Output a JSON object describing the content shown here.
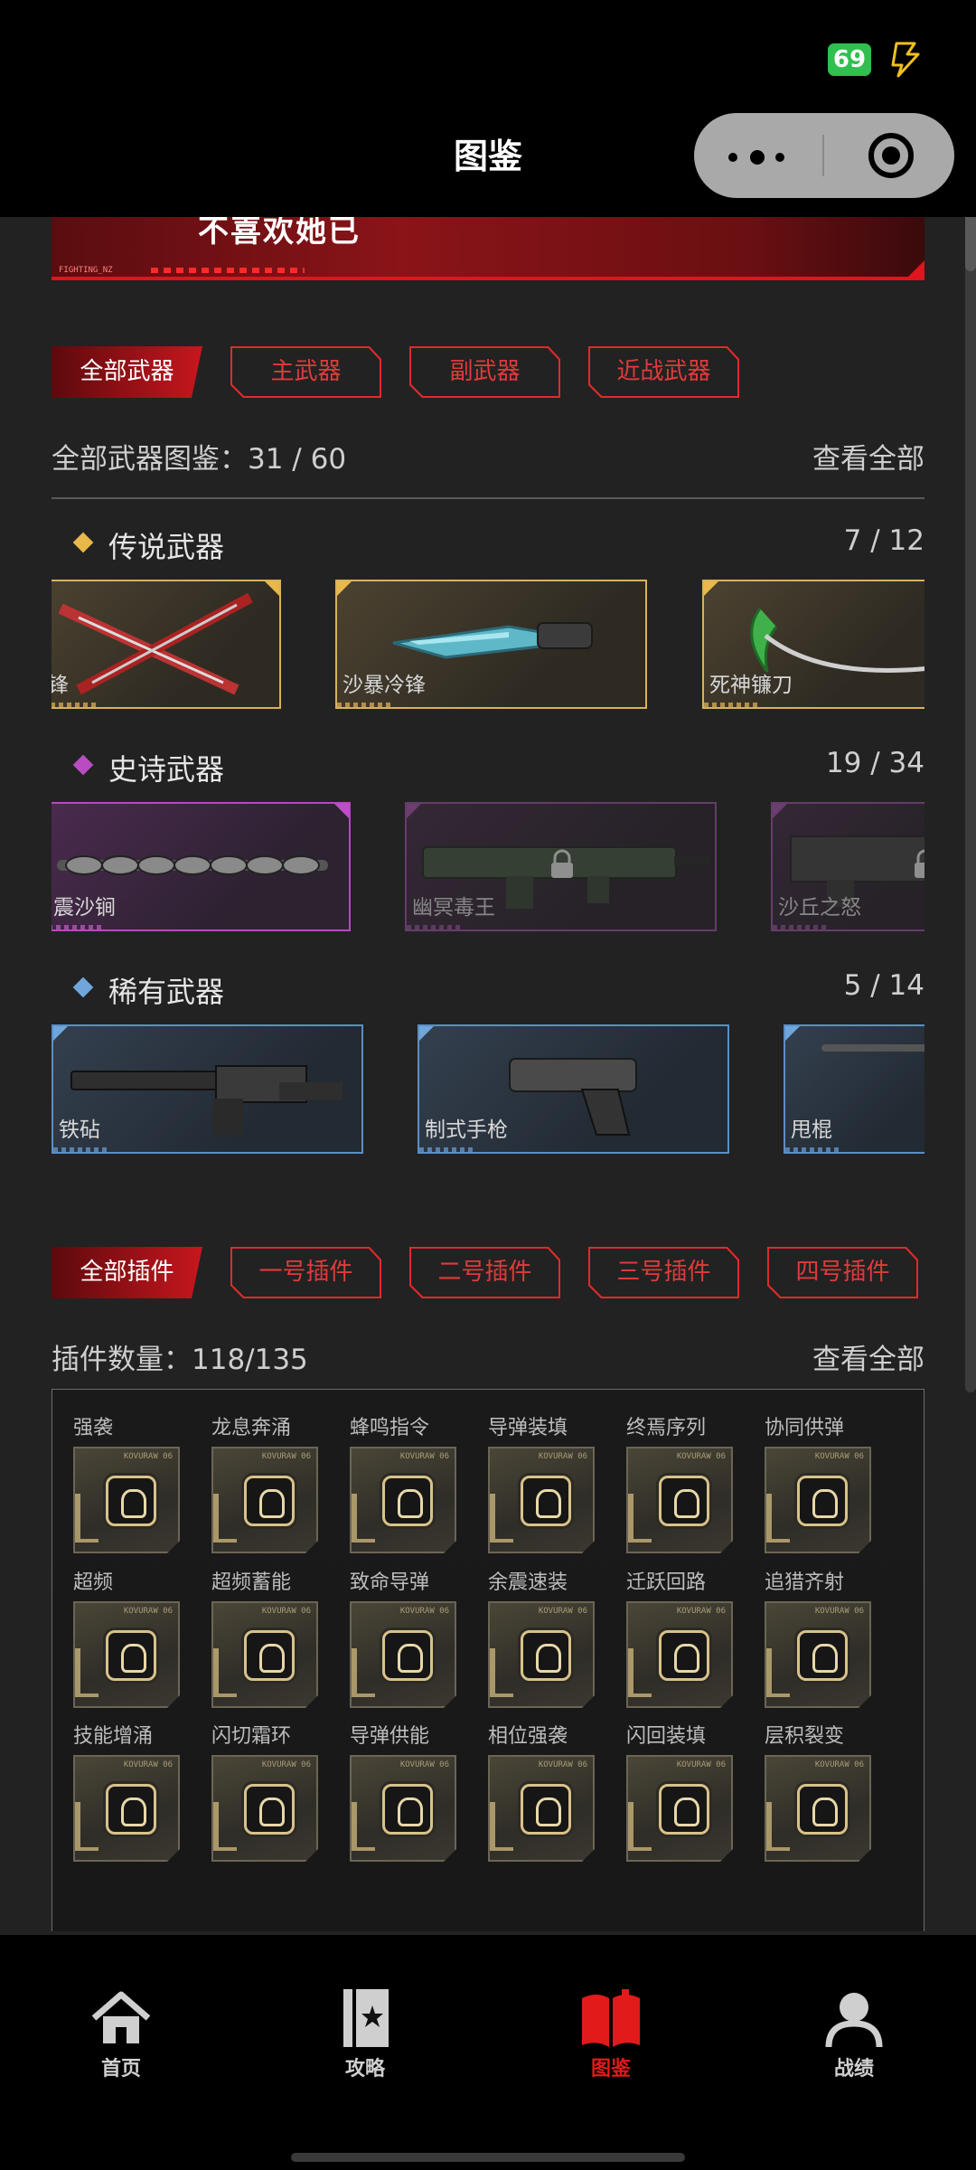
{
  "status_bar": {
    "battery": "69"
  },
  "title_bar": {
    "title": "图鉴"
  },
  "banner": {
    "text": "不喜欢她已",
    "tag": "FIGHTING_NZ"
  },
  "weapon_tabs": [
    "全部武器",
    "主武器",
    "副武器",
    "近战武器"
  ],
  "weapon_summary": {
    "label": "全部武器图鉴：31 / 60",
    "view_all": "查看全部",
    "collected": 31,
    "total": 60
  },
  "categories": [
    {
      "name": "传说武器",
      "count": "7 / 12",
      "color": "#e8b84a",
      "cards": [
        {
          "name": "锋"
        },
        {
          "name": "沙暴冷锋"
        },
        {
          "name": "死神镰刀"
        }
      ]
    },
    {
      "name": "史诗武器",
      "count": "19 / 34",
      "color": "#b84cc0",
      "cards": [
        {
          "name": "震沙锏"
        },
        {
          "name": "幽冥毒王",
          "locked": true
        },
        {
          "name": "沙丘之怒",
          "locked": true
        }
      ]
    },
    {
      "name": "稀有武器",
      "count": "5 / 14",
      "color": "#6fa6dc",
      "cards": [
        {
          "name": "铁砧"
        },
        {
          "name": "制式手枪"
        },
        {
          "name": "甩棍"
        }
      ]
    }
  ],
  "plugin_tabs": [
    "全部插件",
    "一号插件",
    "二号插件",
    "三号插件",
    "四号插件"
  ],
  "plugin_summary": {
    "label": "插件数量：118/135",
    "view_all": "查看全部"
  },
  "plugins": [
    [
      "强袭",
      "龙息奔涌",
      "蜂鸣指令",
      "导弹装填",
      "终焉序列",
      "协同供弹"
    ],
    [
      "超频",
      "超频蓄能",
      "致命导弹",
      "余震速装",
      "迁跃回路",
      "追猎齐射"
    ],
    [
      "技能增涌",
      "闪切霜环",
      "导弹供能",
      "相位强袭",
      "闪回装填",
      "层积裂变"
    ]
  ],
  "bottom_nav": [
    {
      "label": "首页",
      "icon": "home-icon"
    },
    {
      "label": "攻略",
      "icon": "guide-card-icon"
    },
    {
      "label": "图鉴",
      "icon": "codex-book-icon",
      "active": true
    },
    {
      "label": "战绩",
      "icon": "profile-icon"
    }
  ],
  "colors": {
    "accent_red": "#e0141c",
    "legendary": "#e8b84a",
    "epic": "#b84cc0",
    "rare": "#6fa6dc"
  }
}
